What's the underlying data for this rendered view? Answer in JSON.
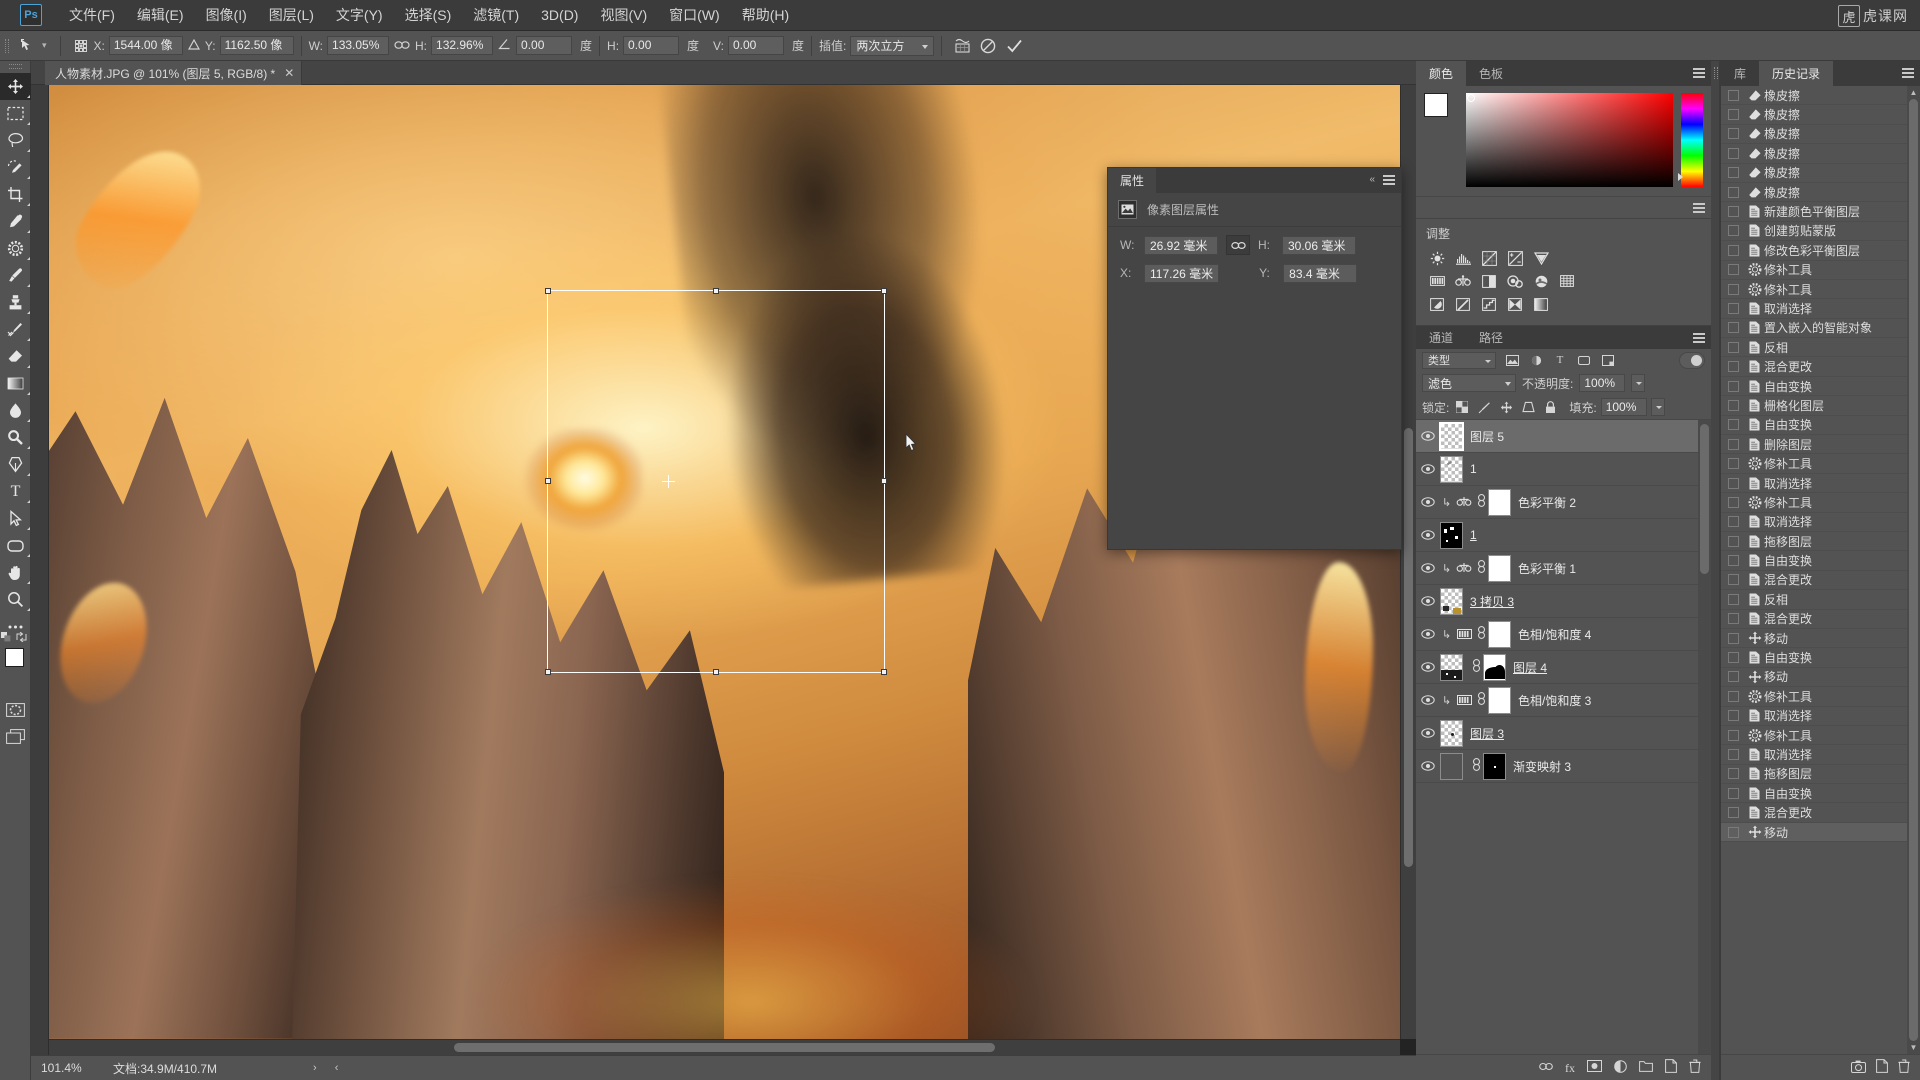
{
  "app": {
    "logo": "Ps",
    "brand_text": "虎课网",
    "brand_box": "虎"
  },
  "menubar": {
    "items": [
      {
        "label": "文件(F)"
      },
      {
        "label": "编辑(E)"
      },
      {
        "label": "图像(I)"
      },
      {
        "label": "图层(L)"
      },
      {
        "label": "文字(Y)"
      },
      {
        "label": "选择(S)"
      },
      {
        "label": "滤镜(T)"
      },
      {
        "label": "3D(D)"
      },
      {
        "label": "视图(V)"
      },
      {
        "label": "窗口(W)"
      },
      {
        "label": "帮助(H)"
      }
    ]
  },
  "optionsbar": {
    "tool_icon": "move-tool-icon",
    "ref_point_icon": "reference-point-icon",
    "x_label": "X:",
    "x_value": "1544.00 像",
    "delta_icon": "delta-icon",
    "y_label": "Y:",
    "y_value": "1162.50 像",
    "w_label": "W:",
    "w_value": "133.05%",
    "chain_icon": "link-icon",
    "h_label": "H:",
    "h_value": "132.96%",
    "angle_icon": "angle-icon",
    "angle_value": "0.00",
    "angle_unit": "度",
    "skew_h_label": "H:",
    "skew_h_value": "0.00",
    "skew_h_unit": "度",
    "skew_v_label": "V:",
    "skew_v_value": "0.00",
    "skew_v_unit": "度",
    "interp_label": "插值:",
    "interp_value": "两次立方",
    "warp_icon": "warp-icon",
    "cancel_icon": "cancel-icon",
    "commit_icon": "commit-icon"
  },
  "toolbox": {
    "tools": [
      {
        "name": "move-tool",
        "icon": "move"
      },
      {
        "name": "marquee-tool",
        "icon": "marquee"
      },
      {
        "name": "lasso-tool",
        "icon": "lasso"
      },
      {
        "name": "quick-selection-tool",
        "icon": "quickselect"
      },
      {
        "name": "crop-tool",
        "icon": "crop"
      },
      {
        "name": "eyedropper-tool",
        "icon": "eyedropper"
      },
      {
        "name": "patch-tool",
        "icon": "patch"
      },
      {
        "name": "brush-tool",
        "icon": "brush"
      },
      {
        "name": "clone-stamp-tool",
        "icon": "stamp"
      },
      {
        "name": "history-brush-tool",
        "icon": "historybrush"
      },
      {
        "name": "eraser-tool",
        "icon": "eraser"
      },
      {
        "name": "gradient-tool",
        "icon": "gradient"
      },
      {
        "name": "blur-tool",
        "icon": "blur"
      },
      {
        "name": "dodge-tool",
        "icon": "dodge"
      },
      {
        "name": "pen-tool",
        "icon": "pen"
      },
      {
        "name": "type-tool",
        "icon": "type"
      },
      {
        "name": "path-selection-tool",
        "icon": "pathselect"
      },
      {
        "name": "rectangle-tool",
        "icon": "rectangle"
      },
      {
        "name": "hand-tool",
        "icon": "hand"
      },
      {
        "name": "zoom-tool",
        "icon": "zoom"
      },
      {
        "name": "more-tools",
        "icon": "ellipsis"
      }
    ],
    "foreground_color": "#ffffff",
    "background_color": "#b08070",
    "quickmask_icon": "quick-mask-icon",
    "screenmode_icon": "screen-mode-icon"
  },
  "document": {
    "tab_title": "人物素材.JPG @ 101% (图层 5, RGB/8) *",
    "close_icon": "close-icon"
  },
  "statusbar": {
    "zoom": "101.4%",
    "doc_info": "文档:34.9M/410.7M",
    "arrow_right": "›",
    "arrow_left": "‹"
  },
  "properties": {
    "tab": "属性",
    "thumb_icon": "pixel-layer-icon",
    "title": "像素图层属性",
    "w_label": "W:",
    "w_value": "26.92 毫米",
    "link_icon": "link-icon",
    "h_label": "H:",
    "h_value": "30.06 毫米",
    "x_label": "X:",
    "x_value": "117.26 毫米",
    "y_label": "Y:",
    "y_value": "83.4 毫米",
    "menu_icon": "panel-menu-icon",
    "collapse_icon": "collapse-icon"
  },
  "color_panel": {
    "tabs": [
      {
        "label": "颜色",
        "active": true
      },
      {
        "label": "色板",
        "active": false
      }
    ],
    "foreground": "#ffffff",
    "background": "#b08070",
    "menu_icon": "panel-menu-icon"
  },
  "adjustments": {
    "title": "调整",
    "row1": [
      "brightness-contrast-icon",
      "levels-icon",
      "curves-icon",
      "exposure-icon",
      "vibrance-icon"
    ],
    "row2": [
      "hue-saturation-icon",
      "color-balance-icon",
      "black-white-icon",
      "photo-filter-icon",
      "channel-mixer-icon",
      "color-lookup-icon"
    ],
    "row3": [
      "invert-icon",
      "posterize-icon",
      "threshold-icon",
      "gradient-map-icon",
      "selective-color-icon"
    ]
  },
  "channels_tabs": {
    "tabs": [
      {
        "label": "通道"
      },
      {
        "label": "路径"
      }
    ],
    "menu_icon": "panel-menu-icon"
  },
  "channel_row": {
    "kind_value": "类型",
    "icons": [
      "pixel-filter-icon",
      "adjustment-filter-icon",
      "type-filter-icon",
      "shape-filter-icon",
      "smartobject-filter-icon"
    ],
    "toggle_name": "filter-toggle"
  },
  "layers": {
    "blend_mode": "滤色",
    "opacity_label": "不透明度:",
    "opacity_value": "100%",
    "lock_label": "锁定:",
    "fill_label": "填充:",
    "fill_value": "100%",
    "lock_icons": [
      "lock-transparent-icon",
      "lock-image-icon",
      "lock-position-icon",
      "lock-artboard-icon",
      "lock-all-icon"
    ],
    "rows": [
      {
        "name": "图层 5",
        "selected": true,
        "thumb": "checker",
        "eye": true,
        "underline": false,
        "clip": false,
        "kind": "pixel"
      },
      {
        "name": "1",
        "selected": false,
        "thumb": "checker",
        "eye": true,
        "underline": false,
        "clip": false,
        "kind": "pixel"
      },
      {
        "name": "色彩平衡 2",
        "selected": false,
        "thumb": "white",
        "eye": true,
        "underline": false,
        "clip": true,
        "kind": "adjust-balance"
      },
      {
        "name": "1",
        "selected": false,
        "thumb": "black",
        "eye": true,
        "underline": true,
        "clip": false,
        "kind": "pixel"
      },
      {
        "name": "色彩平衡 1",
        "selected": false,
        "thumb": "white",
        "eye": true,
        "underline": false,
        "clip": true,
        "kind": "adjust-balance"
      },
      {
        "name": "3 拷贝 3",
        "selected": false,
        "thumb": "checker",
        "eye": true,
        "underline": true,
        "clip": false,
        "kind": "pixel"
      },
      {
        "name": "色相/饱和度 4",
        "selected": false,
        "thumb": "white",
        "eye": true,
        "underline": false,
        "clip": true,
        "kind": "adjust-hue"
      },
      {
        "name": "图层 4",
        "selected": false,
        "thumb": "checker",
        "eye": true,
        "underline": true,
        "clip": false,
        "kind": "masked"
      },
      {
        "name": "色相/饱和度 3",
        "selected": false,
        "thumb": "white",
        "eye": true,
        "underline": false,
        "clip": true,
        "kind": "adjust-hue"
      },
      {
        "name": "图层 3",
        "selected": false,
        "thumb": "checker",
        "eye": true,
        "underline": true,
        "clip": false,
        "kind": "pixel"
      },
      {
        "name": "渐变映射 3",
        "selected": false,
        "thumb": "grad",
        "eye": true,
        "underline": false,
        "clip": false,
        "kind": "gradmap"
      }
    ],
    "footer_icons": [
      "link-layers-icon",
      "layer-style-icon",
      "add-mask-icon",
      "new-adjustment-icon",
      "new-group-icon",
      "new-layer-icon",
      "delete-layer-icon"
    ]
  },
  "history": {
    "tabs": [
      {
        "label": "库",
        "active": false
      },
      {
        "label": "历史记录",
        "active": true
      }
    ],
    "menu_icon": "panel-menu-icon",
    "items": [
      {
        "label": "橡皮擦",
        "icon": "eraser-icon"
      },
      {
        "label": "橡皮擦",
        "icon": "eraser-icon"
      },
      {
        "label": "橡皮擦",
        "icon": "eraser-icon"
      },
      {
        "label": "橡皮擦",
        "icon": "eraser-icon"
      },
      {
        "label": "橡皮擦",
        "icon": "eraser-icon"
      },
      {
        "label": "橡皮擦",
        "icon": "eraser-icon"
      },
      {
        "label": "新建颜色平衡图层",
        "icon": "doc-icon"
      },
      {
        "label": "创建剪贴蒙版",
        "icon": "doc-icon"
      },
      {
        "label": "修改色彩平衡图层",
        "icon": "doc-icon"
      },
      {
        "label": "修补工具",
        "icon": "patch-icon"
      },
      {
        "label": "修补工具",
        "icon": "patch-icon"
      },
      {
        "label": "取消选择",
        "icon": "doc-icon"
      },
      {
        "label": "置入嵌入的智能对象",
        "icon": "doc-icon"
      },
      {
        "label": "反相",
        "icon": "doc-icon"
      },
      {
        "label": "混合更改",
        "icon": "doc-icon"
      },
      {
        "label": "自由变换",
        "icon": "doc-icon"
      },
      {
        "label": "栅格化图层",
        "icon": "doc-icon"
      },
      {
        "label": "自由变换",
        "icon": "doc-icon"
      },
      {
        "label": "删除图层",
        "icon": "doc-icon"
      },
      {
        "label": "修补工具",
        "icon": "patch-icon"
      },
      {
        "label": "取消选择",
        "icon": "doc-icon"
      },
      {
        "label": "修补工具",
        "icon": "patch-icon"
      },
      {
        "label": "取消选择",
        "icon": "doc-icon"
      },
      {
        "label": "拖移图层",
        "icon": "doc-icon"
      },
      {
        "label": "自由变换",
        "icon": "doc-icon"
      },
      {
        "label": "混合更改",
        "icon": "doc-icon"
      },
      {
        "label": "反相",
        "icon": "doc-icon"
      },
      {
        "label": "混合更改",
        "icon": "doc-icon"
      },
      {
        "label": "移动",
        "icon": "move-icon"
      },
      {
        "label": "自由变换",
        "icon": "doc-icon"
      },
      {
        "label": "移动",
        "icon": "move-icon"
      },
      {
        "label": "修补工具",
        "icon": "patch-icon"
      },
      {
        "label": "取消选择",
        "icon": "doc-icon"
      },
      {
        "label": "修补工具",
        "icon": "patch-icon"
      },
      {
        "label": "取消选择",
        "icon": "doc-icon"
      },
      {
        "label": "拖移图层",
        "icon": "doc-icon"
      },
      {
        "label": "自由变换",
        "icon": "doc-icon"
      },
      {
        "label": "混合更改",
        "icon": "doc-icon"
      },
      {
        "label": "移动",
        "icon": "move-icon",
        "active": true
      }
    ],
    "footer_icons": [
      "snapshot-icon",
      "new-document-icon",
      "delete-state-icon"
    ]
  },
  "colors": {
    "panel_bg": "#535353",
    "panel_dark": "#3b3b3b",
    "selection_blue": "#6b6b6b",
    "accent": "#4aa3d8"
  }
}
